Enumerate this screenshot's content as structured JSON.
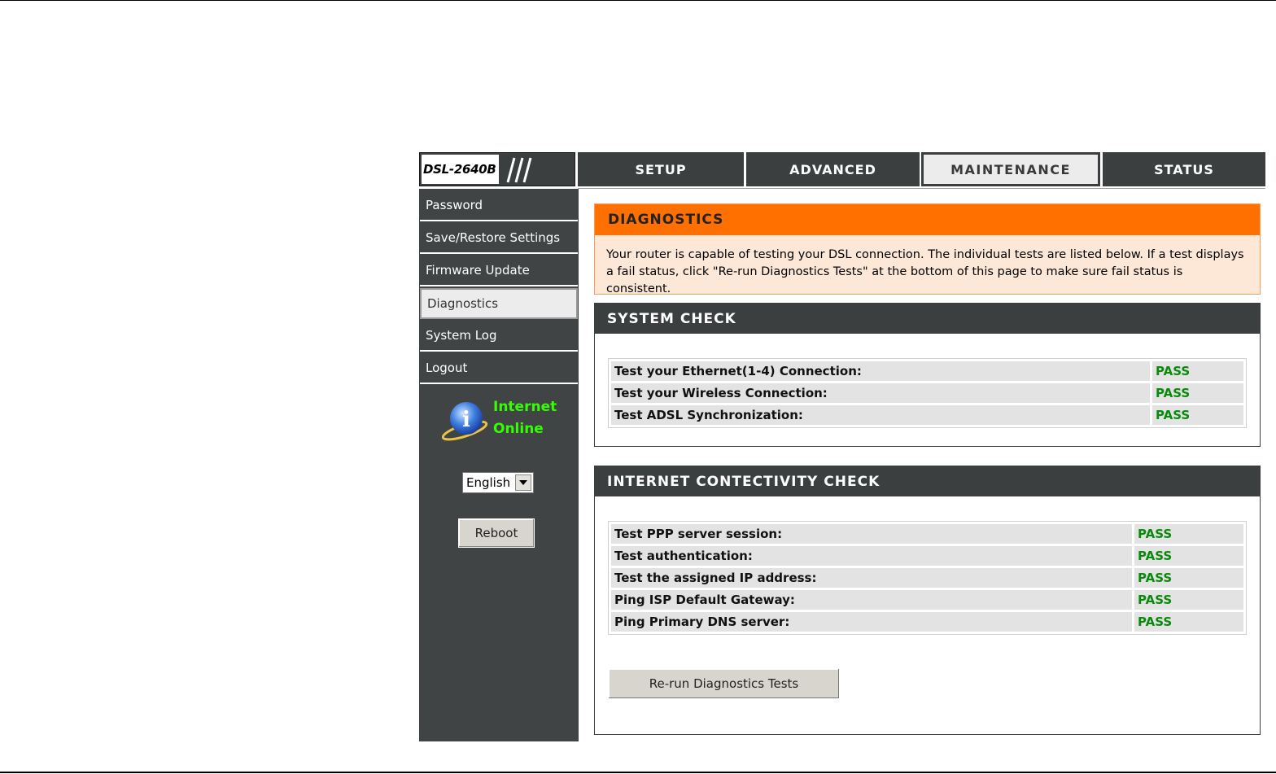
{
  "header": {
    "model": "DSL-2640B",
    "tabs": [
      {
        "label": "SETUP"
      },
      {
        "label": "ADVANCED"
      },
      {
        "label": "MAINTENANCE"
      },
      {
        "label": "STATUS"
      }
    ]
  },
  "sidebar": {
    "items": [
      {
        "label": "Password"
      },
      {
        "label": "Save/Restore Settings"
      },
      {
        "label": "Firmware Update"
      },
      {
        "label": "Diagnostics"
      },
      {
        "label": "System Log"
      },
      {
        "label": "Logout"
      }
    ],
    "status_line1": "Internet",
    "status_line2": "Online",
    "language": "English",
    "reboot_label": "Reboot"
  },
  "diagnostics": {
    "title": "DIAGNOSTICS",
    "description": "Your router is capable of testing your DSL connection. The individual tests are listed below. If a test displays a fail status, click \"Re-run Diagnostics Tests\" at the bottom of this page to make sure fail status is consistent."
  },
  "system_check": {
    "title": "SYSTEM CHECK",
    "tests": [
      {
        "label": "Test your Ethernet(1-4) Connection:",
        "result": "PASS"
      },
      {
        "label": "Test your Wireless Connection:",
        "result": "PASS"
      },
      {
        "label": "Test ADSL Synchronization:",
        "result": "PASS"
      }
    ]
  },
  "internet_check": {
    "title": "INTERNET CONTECTIVITY CHECK",
    "tests": [
      {
        "label": "Test PPP server session:",
        "result": "PASS"
      },
      {
        "label": "Test authentication:",
        "result": "PASS"
      },
      {
        "label": "Test the assigned IP address:",
        "result": "PASS"
      },
      {
        "label": "Ping ISP Default Gateway:",
        "result": "PASS"
      },
      {
        "label": "Ping Primary DNS server:",
        "result": "PASS"
      }
    ],
    "rerun_label": "Re-run Diagnostics Tests"
  },
  "colors": {
    "nav_bg": "#3b3f40",
    "accent_orange": "#ff7000",
    "pass_green": "#0a8a0a",
    "online_green": "#33ff00"
  },
  "icons": [
    "info-globe-icon",
    "dropdown-arrow-icon"
  ]
}
